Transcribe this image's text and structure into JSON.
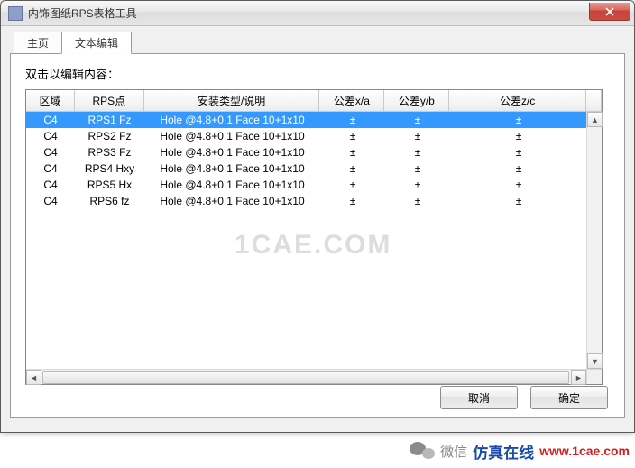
{
  "window": {
    "title": "内饰图纸RPS表格工具"
  },
  "tabs": [
    {
      "label": "主页"
    },
    {
      "label": "文本编辑"
    }
  ],
  "hint": "双击以编辑内容：",
  "columns": [
    "区域",
    "RPS点",
    "安装类型/说明",
    "公差x/a",
    "公差y/b",
    "公差z/c"
  ],
  "rows": [
    {
      "area": "C4",
      "rps": "RPS1 Fz",
      "desc": "Hole @4.8+0.1 Face 10+1x10",
      "x": "±",
      "y": "±",
      "z": "±",
      "selected": true
    },
    {
      "area": "C4",
      "rps": "RPS2 Fz",
      "desc": "Hole @4.8+0.1 Face 10+1x10",
      "x": "±",
      "y": "±",
      "z": "±",
      "selected": false
    },
    {
      "area": "C4",
      "rps": "RPS3 Fz",
      "desc": "Hole @4.8+0.1 Face 10+1x10",
      "x": "±",
      "y": "±",
      "z": "±",
      "selected": false
    },
    {
      "area": "C4",
      "rps": "RPS4 Hxy",
      "desc": "Hole @4.8+0.1 Face 10+1x10",
      "x": "±",
      "y": "±",
      "z": "±",
      "selected": false
    },
    {
      "area": "C4",
      "rps": "RPS5 Hx",
      "desc": "Hole @4.8+0.1 Face 10+1x10",
      "x": "±",
      "y": "±",
      "z": "±",
      "selected": false
    },
    {
      "area": "C4",
      "rps": "RPS6 fz",
      "desc": "Hole @4.8+0.1 Face 10+1x10",
      "x": "±",
      "y": "±",
      "z": "±",
      "selected": false
    }
  ],
  "buttons": {
    "cancel": "取消",
    "ok": "确定"
  },
  "watermark": "1CAE.COM",
  "footer": {
    "wechat_label": "微信",
    "brand": "仿真在线",
    "url": "www.1cae.com"
  }
}
